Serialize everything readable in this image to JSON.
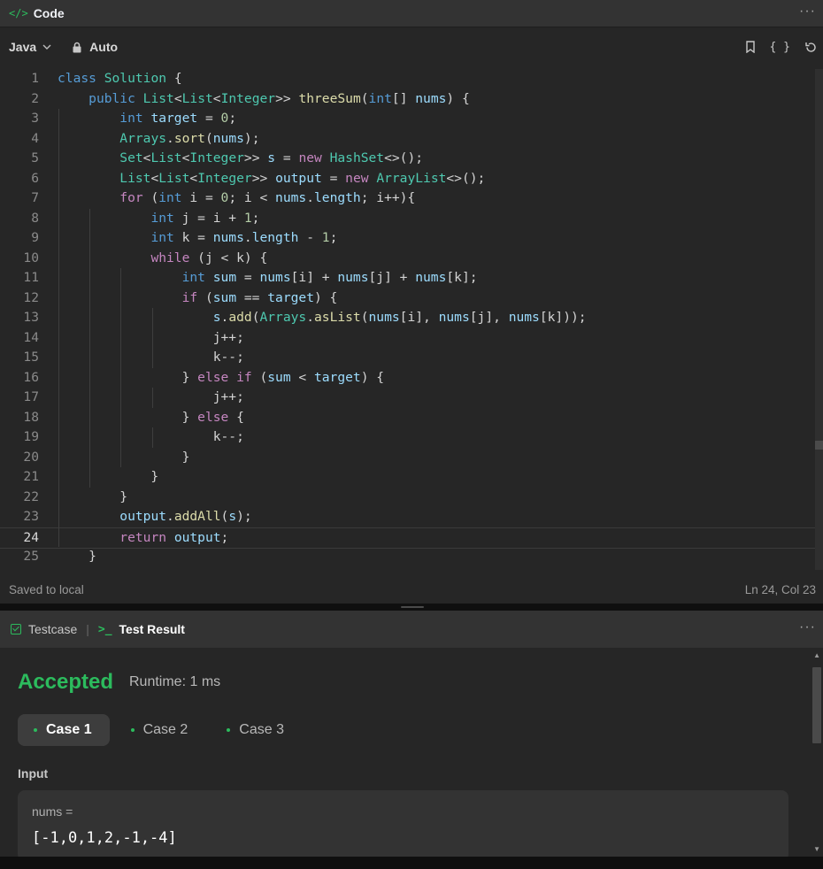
{
  "code_panel": {
    "title": "Code",
    "title_icon": "code-icon",
    "more": "···",
    "language": "Java",
    "mode": "Auto",
    "toolbar_icons": [
      "bookmark-icon",
      "format-braces-icon",
      "reset-icon"
    ],
    "braces_label": "{ }",
    "status_left": "Saved to local",
    "status_right": "Ln 24, Col 23",
    "active_line": 24,
    "lines": [
      "class Solution {",
      "    public List<List<Integer>> threeSum(int[] nums) {",
      "        int target = 0;",
      "        Arrays.sort(nums);",
      "        Set<List<Integer>> s = new HashSet<>();",
      "        List<List<Integer>> output = new ArrayList<>();",
      "        for (int i = 0; i < nums.length; i++){",
      "            int j = i + 1;",
      "            int k = nums.length - 1;",
      "            while (j < k) {",
      "                int sum = nums[i] + nums[j] + nums[k];",
      "                if (sum == target) {",
      "                    s.add(Arrays.asList(nums[i], nums[j], nums[k]));",
      "                    j++;",
      "                    k--;",
      "                } else if (sum < target) {",
      "                    j++;",
      "                } else {",
      "                    k--;",
      "                }",
      "            }",
      "        }",
      "        output.addAll(s);",
      "        return output;",
      "    }"
    ]
  },
  "result_panel": {
    "tab_testcase": "Testcase",
    "tab_separator": "|",
    "tab_result": "Test Result",
    "more": "···",
    "status": "Accepted",
    "runtime": "Runtime: 1 ms",
    "cases": [
      "Case 1",
      "Case 2",
      "Case 3"
    ],
    "active_case": 0,
    "input_label": "Input",
    "input_name": "nums =",
    "input_value": "[-1,0,1,2,-1,-4]"
  },
  "colors": {
    "accent_green": "#2cbb5d",
    "panel_bg": "#262626",
    "header_bg": "#333333"
  }
}
